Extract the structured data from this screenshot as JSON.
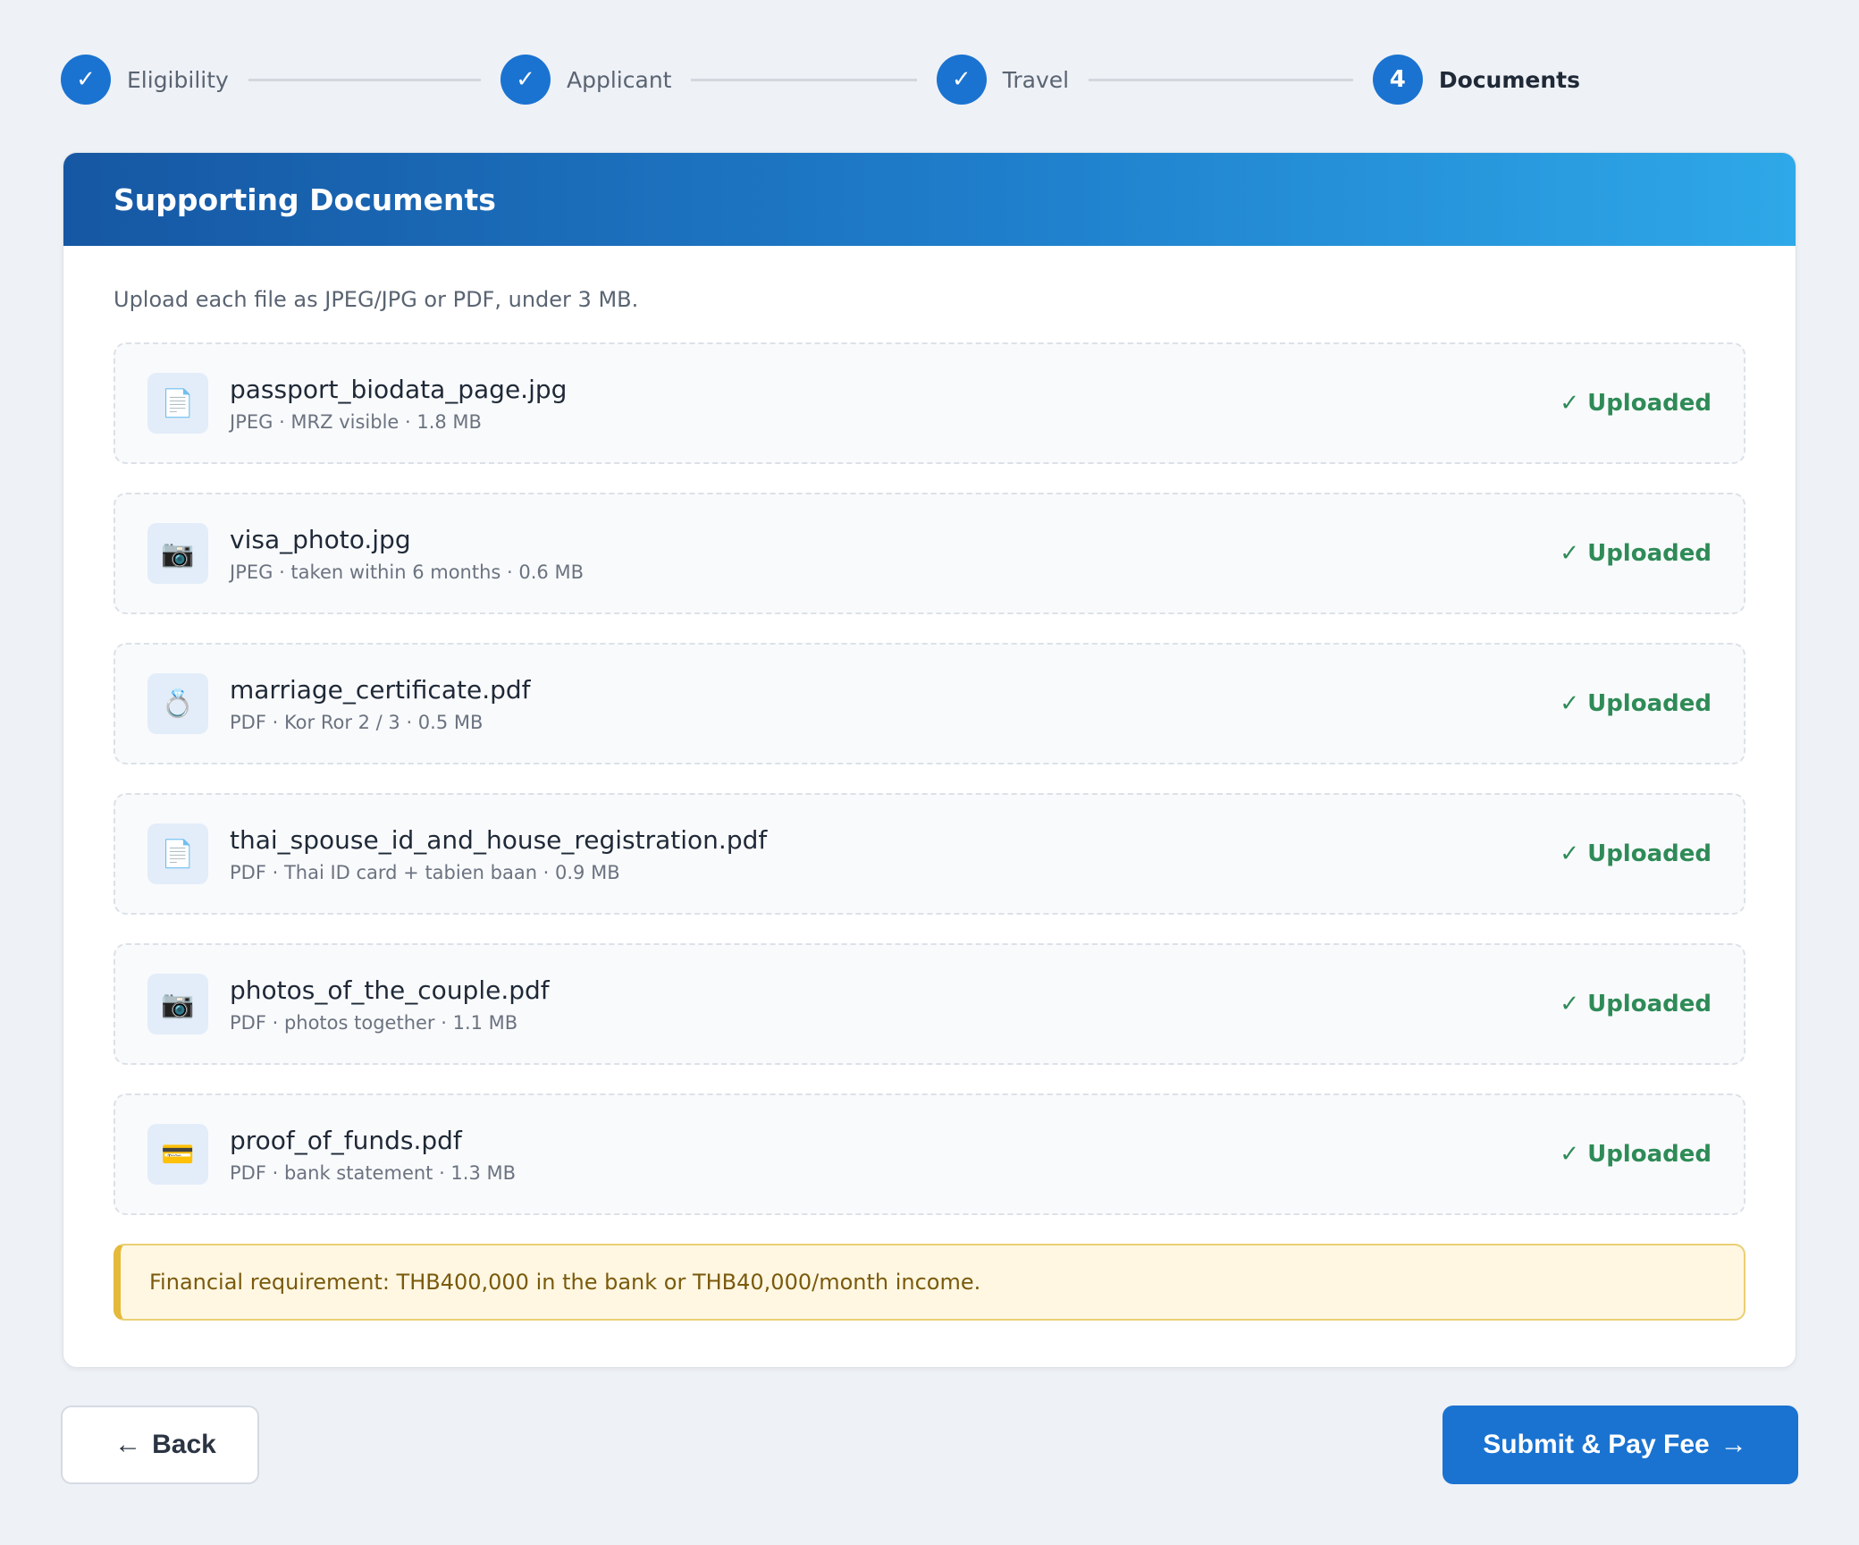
{
  "stepper": {
    "steps": [
      {
        "label": "Eligibility",
        "mark": "✓",
        "state": "done"
      },
      {
        "label": "Applicant",
        "mark": "✓",
        "state": "done"
      },
      {
        "label": "Travel",
        "mark": "✓",
        "state": "done"
      },
      {
        "label": "Documents",
        "mark": "4",
        "state": "active"
      }
    ]
  },
  "card": {
    "title": "Supporting Documents",
    "instructions": "Upload each file as JPEG/JPG or PDF, under 3 MB.",
    "documents": [
      {
        "icon": "📄",
        "icon_name": "document-icon",
        "name": "passport_biodata_page.jpg",
        "meta": "JPEG · MRZ visible · 1.8 MB",
        "status": "✓ Uploaded"
      },
      {
        "icon": "📷",
        "icon_name": "camera-icon",
        "name": "visa_photo.jpg",
        "meta": "JPEG · taken within 6 months · 0.6 MB",
        "status": "✓ Uploaded"
      },
      {
        "icon": "💍",
        "icon_name": "ring-icon",
        "name": "marriage_certificate.pdf",
        "meta": "PDF · Kor Ror 2 / 3 · 0.5 MB",
        "status": "✓ Uploaded"
      },
      {
        "icon": "📄",
        "icon_name": "document-icon",
        "name": "thai_spouse_id_and_house_registration.pdf",
        "meta": "PDF · Thai ID card + tabien baan · 0.9 MB",
        "status": "✓ Uploaded"
      },
      {
        "icon": "📷",
        "icon_name": "camera-icon",
        "name": "photos_of_the_couple.pdf",
        "meta": "PDF · photos together · 1.1 MB",
        "status": "✓ Uploaded"
      },
      {
        "icon": "💳",
        "icon_name": "credit-card-icon",
        "name": "proof_of_funds.pdf",
        "meta": "PDF · bank statement · 1.3 MB",
        "status": "✓ Uploaded"
      }
    ],
    "notice": "Financial requirement: THB400,000 in the bank or THB40,000/month income."
  },
  "actions": {
    "back_arrow": "←",
    "back_label": "Back",
    "submit_label": "Submit & Pay Fee",
    "submit_arrow": "→"
  },
  "colors": {
    "primary": "#1a73d1",
    "success": "#2e8b57",
    "warning_border": "#e5b93a"
  }
}
